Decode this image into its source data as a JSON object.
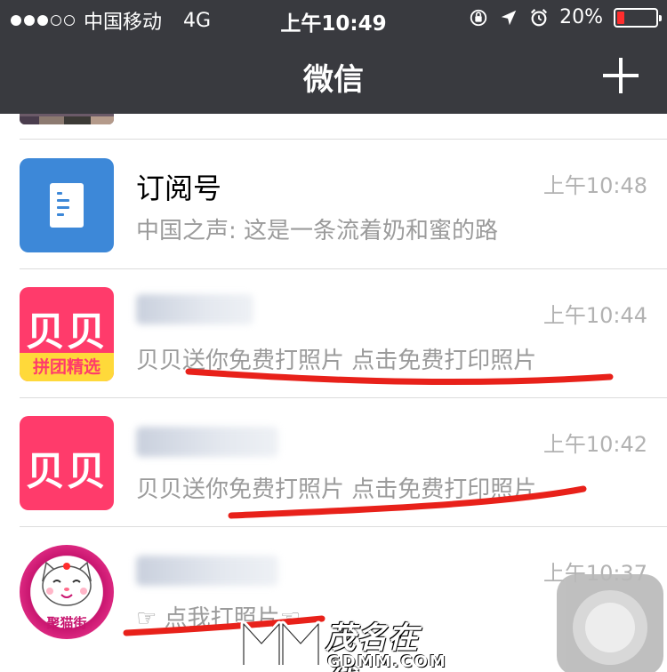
{
  "status_bar": {
    "carrier": "中国移动",
    "network": "4G",
    "time": "上午10:49",
    "battery_percent": "20%",
    "battery_level": 0.2,
    "icons": [
      "orientation-lock-icon",
      "location-arrow-icon",
      "alarm-clock-icon",
      "battery-icon"
    ],
    "signal_bars_filled": 3,
    "signal_bars_total": 5
  },
  "nav": {
    "title": "微信",
    "add_icon": "plus-icon"
  },
  "colors": {
    "header_bg": "#393a3f",
    "battery_low": "#ff2d2d",
    "subscription_blue": "#3d88d8",
    "beibei_pink": "#ff3b6b",
    "underline_red": "#e8211a",
    "time_gray": "#b2b2b2",
    "preview_gray": "#9b9b9b"
  },
  "chats": [
    {
      "title": "订阅号",
      "time": "上午10:48",
      "preview": "中国之声: 这是一条流着奶和蜜的路",
      "avatar": "subscription-icon"
    },
    {
      "title": "",
      "time": "上午10:44",
      "preview": "贝贝送你免费打照片 点击免费打印照片",
      "avatar": "beibei-group-buy-avatar",
      "avatar_text": "贝贝",
      "avatar_banner": "拼团精选"
    },
    {
      "title": "",
      "time": "上午10:42",
      "preview": "贝贝送你免费打照片 点击免费打印照片",
      "avatar": "beibei-avatar",
      "avatar_text": "贝贝"
    },
    {
      "title": "",
      "time": "上午10:37",
      "preview": "☞ 点我打照片☜",
      "avatar": "lucky-cat-avatar",
      "avatar_label": "聚猫街"
    }
  ],
  "watermark": {
    "main": "茂名在线",
    "sub": "GDMM.COM"
  }
}
